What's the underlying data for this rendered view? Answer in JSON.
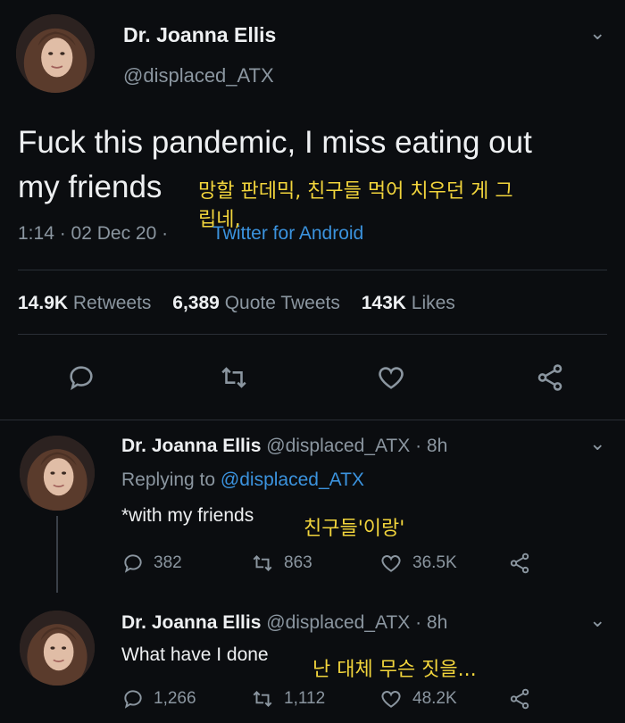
{
  "main_tweet": {
    "author_name": "Dr. Joanna Ellis",
    "handle": "@displaced_ATX",
    "text_line1": "Fuck this pandemic, I miss eating out",
    "text_line2": "my friends",
    "overlay_line1": "망할 판데믹, 친구들 먹어 치우던 게 그",
    "overlay_line2": "립네,",
    "timestamp": "1:14 · 02 Dec 20 ·",
    "source": "Twitter for Android",
    "retweets_count": "14.9K",
    "retweets_label": "Retweets",
    "quotes_count": "6,389",
    "quotes_label": "Quote Tweets",
    "likes_count": "143K",
    "likes_label": "Likes",
    "action_icons": [
      "reply-icon",
      "retweet-icon",
      "like-icon",
      "share-icon"
    ]
  },
  "replies": [
    {
      "author_name": "Dr. Joanna Ellis",
      "meta": "@displaced_ATX · 8h",
      "replying_prefix": "Replying to",
      "replying_handle": "@displaced_ATX",
      "text": "*with my friends",
      "overlay": "친구들'이랑'",
      "reply_count": "382",
      "retweet_count": "863",
      "like_count": "36.5K"
    },
    {
      "author_name": "Dr. Joanna Ellis",
      "meta": "@displaced_ATX · 8h",
      "text": "What have I done",
      "overlay": "난 대체 무슨 짓을...",
      "reply_count": "1,266",
      "retweet_count": "1,112",
      "like_count": "48.2K"
    }
  ],
  "colors": {
    "background": "#0b0d10",
    "link": "#3b93de",
    "muted": "#8b96a0",
    "overlay_text": "#f2d53c"
  }
}
